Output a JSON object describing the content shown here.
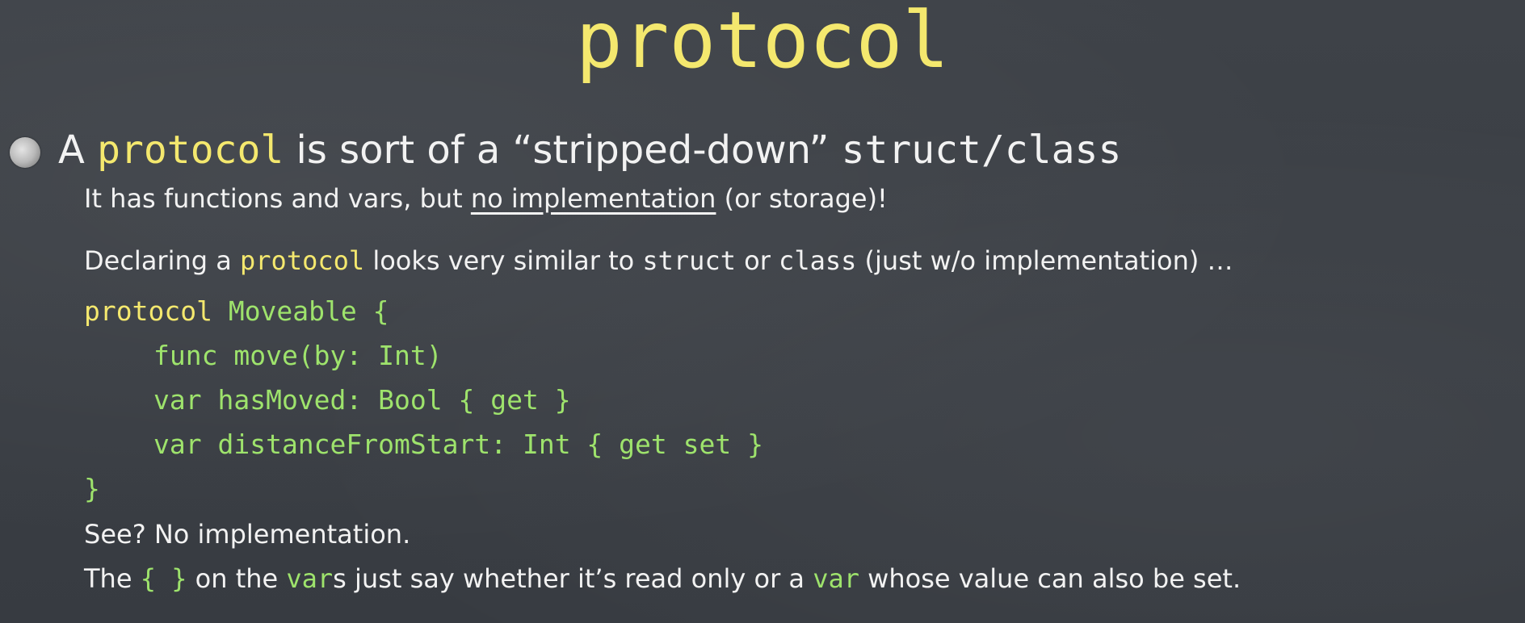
{
  "title": "protocol",
  "headline": {
    "a": "A ",
    "keyword": "protocol",
    "mid": " is sort of a “stripped-down” ",
    "code": "struct/class"
  },
  "sub1": {
    "before": "It has functions and vars, but ",
    "underlined": "no implementation",
    "after": " (or storage)!"
  },
  "sub2": {
    "before": "Declaring a ",
    "keyword": "protocol",
    "mid1": " looks very similar to ",
    "code1": "struct",
    "mid2": " or ",
    "code2": "class",
    "after": " (just w/o implementation) …"
  },
  "code": {
    "line1_kw": "protocol",
    "line1_rest": " Moveable {",
    "line2": "func move(by: Int)",
    "line3": "var hasMoved: Bool { get }",
    "line4": "var distanceFromStart: Int { get set }",
    "line5": "}"
  },
  "sub3": "See? No implementation.",
  "sub4": {
    "before": "The ",
    "braces": "{ }",
    "mid1": " on the ",
    "var1": "var",
    "mid2": "s just say whether it’s read only or a ",
    "var2": "var",
    "after": " whose value can also be set."
  }
}
